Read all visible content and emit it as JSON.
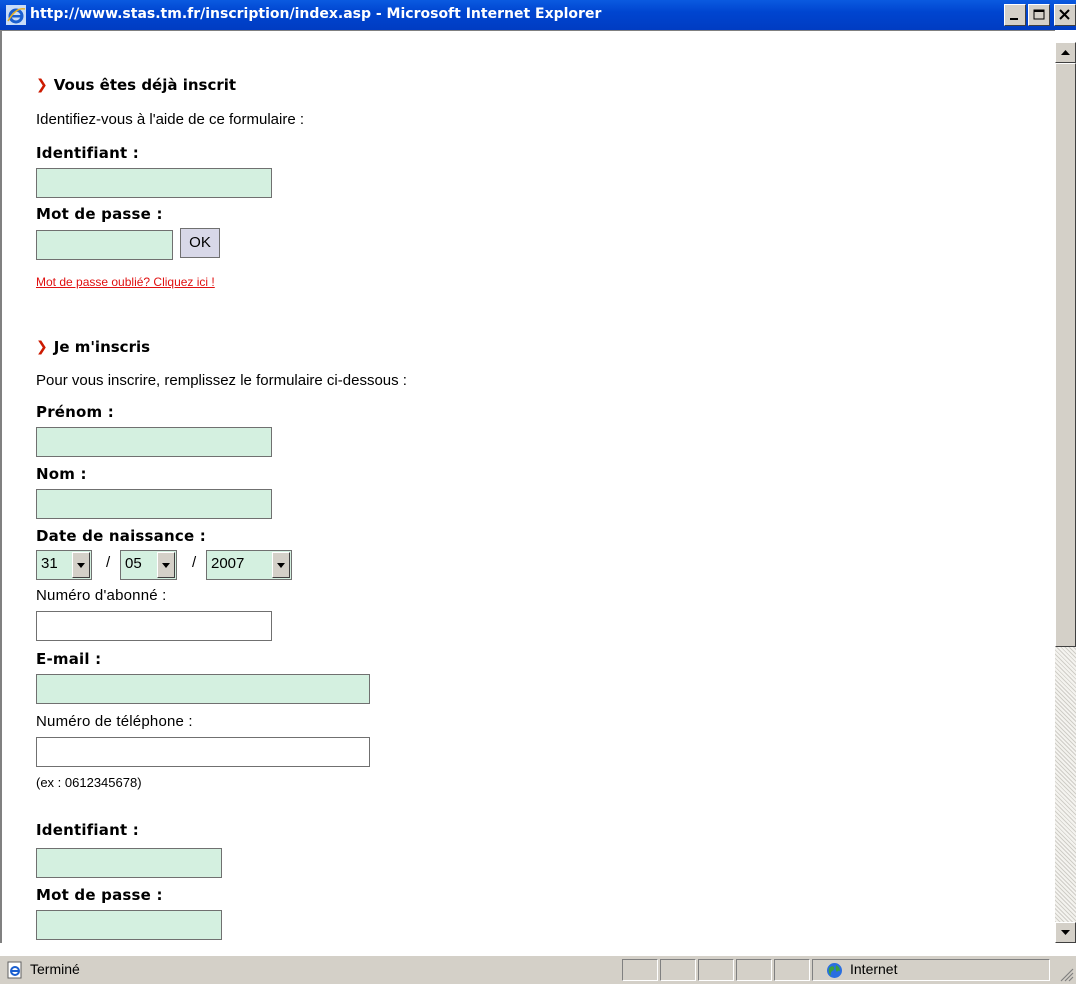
{
  "window": {
    "title": "http://www.stas.tm.fr/inscription/index.asp - Microsoft Internet Explorer"
  },
  "login": {
    "heading": "Vous êtes déjà inscrit",
    "intro": "Identifiez-vous à l'aide de ce formulaire :",
    "id_label": "Identifiant :",
    "pw_label": "Mot de passe :",
    "ok_label": "OK",
    "forgot_link": "Mot de passe oublié? Cliquez ici !"
  },
  "register": {
    "heading": "Je m'inscris",
    "intro": "Pour vous inscrire, remplissez le formulaire ci-dessous :",
    "firstname_label": "Prénom :",
    "lastname_label": "Nom :",
    "birthdate_label": "Date de naissance :",
    "birth_day": "31",
    "birth_month": "05",
    "birth_year": "2007",
    "date_sep": "/",
    "subscriber_label": "Numéro d'abonné :",
    "email_label": "E-mail :",
    "phone_label": "Numéro de téléphone :",
    "phone_hint": "(ex : 0612345678)",
    "id_label": "Identifiant :",
    "pw_label": "Mot de passe :"
  },
  "statusbar": {
    "status": "Terminé",
    "zone": "Internet"
  },
  "colors": {
    "titlebar": "#0045d0",
    "field_required": "#d4f0e0",
    "link": "#e01010",
    "chevron": "#cc1a00",
    "chrome": "#d4d0c8"
  },
  "icons": [
    "ie-logo-icon",
    "minimize-icon",
    "maximize-icon",
    "close-icon",
    "chevron-right-icon",
    "dropdown-arrow-icon",
    "scroll-up-icon",
    "scroll-down-icon",
    "page-done-icon",
    "globe-icon",
    "resize-grip-icon"
  ]
}
